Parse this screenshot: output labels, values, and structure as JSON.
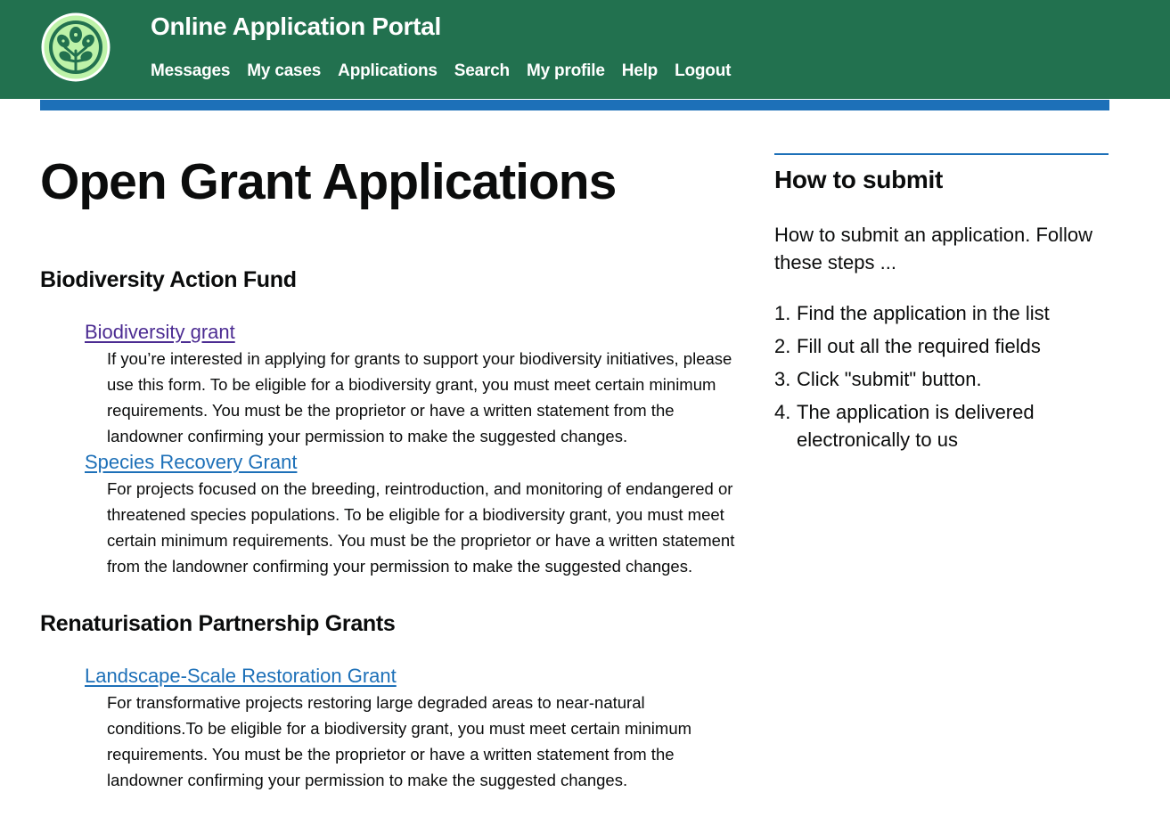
{
  "header": {
    "title": "Online Application Portal",
    "nav": [
      "Messages",
      "My cases",
      "Applications",
      "Search",
      "My profile",
      "Help",
      "Logout"
    ],
    "logo_icon": "tree-leaves-icon"
  },
  "main": {
    "page_title": "Open Grant Applications",
    "sections": [
      {
        "title": "Biodiversity Action Fund",
        "grants": [
          {
            "link": "Biodiversity grant",
            "description": "If you’re interested in applying for grants to support your biodiversity initiatives, please use this form. To be eligible for a biodiversity grant, you must meet certain minimum requirements. You must be the proprietor or have a written statement from the landowner confirming your permission to make the suggested changes."
          },
          {
            "link": "Species Recovery Grant",
            "description": "For projects focused on the breeding, reintroduction, and monitoring of endangered or threatened species populations. To be eligible for a biodiversity grant, you must meet certain minimum requirements. You must be the proprietor or have a written statement from the landowner confirming your permission to make the suggested changes."
          }
        ]
      },
      {
        "title": "Renaturisation Partnership Grants",
        "grants": [
          {
            "link": "Landscape-Scale Restoration Grant",
            "description": "For transformative projects restoring large degraded areas to near-natural conditions.To be eligible for a biodiversity grant, you must meet certain minimum requirements. You must be the proprietor or have a written statement from the landowner confirming your permission to make the suggested changes."
          }
        ]
      }
    ]
  },
  "sidebar": {
    "title": "How to submit",
    "intro": "How to submit an application. Follow these steps ...",
    "steps": [
      "Find the application in the list",
      "Fill out all the required fields",
      "Click \"submit\" button.",
      "The application is delivered electronically to us"
    ]
  },
  "colors": {
    "header_bg": "#22714f",
    "accent": "#1d70b8",
    "link": "#1d70b8",
    "visited_link": "#4c2c92",
    "text": "#0b0c0c"
  }
}
